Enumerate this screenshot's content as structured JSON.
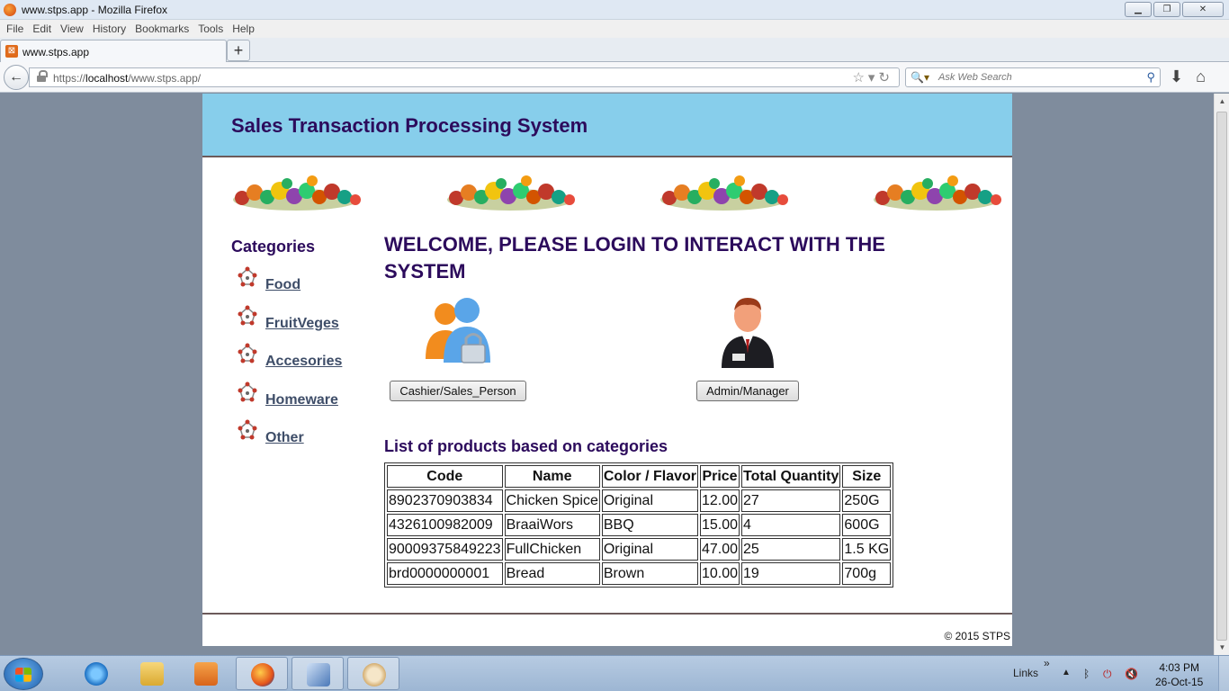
{
  "window": {
    "title": "www.stps.app - Mozilla Firefox",
    "minimize": "▁",
    "maximize": "❐",
    "close": "✕"
  },
  "menu": [
    "File",
    "Edit",
    "View",
    "History",
    "Bookmarks",
    "Tools",
    "Help"
  ],
  "tab": {
    "label": "www.stps.app",
    "new_tab": "+"
  },
  "nav": {
    "url_prefix": "https://",
    "url_host": "localhost",
    "url_path": "/www.stps.app/",
    "search_placeholder": "Ask Web Search",
    "search_engine_glyph": "🔍▾"
  },
  "site": {
    "title": "Sales Transaction Processing System",
    "categories_heading": "Categories",
    "categories": [
      "Food",
      "FruitVeges",
      "Accesories",
      "Homeware",
      "Other"
    ],
    "welcome": "WELCOME, PLEASE LOGIN TO INTERACT WITH THE SYSTEM",
    "cashier_button": "Cashier/Sales_Person",
    "admin_button": "Admin/Manager",
    "products_heading": "List of products based on categories",
    "table": {
      "headers": [
        "Code",
        "Name",
        "Color / Flavor",
        "Price",
        "Total Quantity",
        "Size"
      ],
      "rows": [
        [
          "8902370903834",
          "Chicken Spice",
          "Original",
          "12.00",
          "27",
          "250G"
        ],
        [
          "4326100982009",
          "BraaiWors",
          "BBQ",
          "15.00",
          "4",
          "600G"
        ],
        [
          "90009375849223",
          "FullChicken",
          "Original",
          "47.00",
          "25",
          "1.5 KG"
        ],
        [
          "brd0000000001",
          "Bread",
          "Brown",
          "10.00",
          "19",
          "700g"
        ]
      ]
    },
    "footer": "© 2015 STPS"
  },
  "taskbar": {
    "links": "Links",
    "time": "4:03 PM",
    "date": "26-Oct-15"
  },
  "colors": {
    "header_bg": "#87ceeb",
    "heading": "#2c0b5c",
    "link": "#3e4d68",
    "page_bg": "#7f8c9d"
  }
}
